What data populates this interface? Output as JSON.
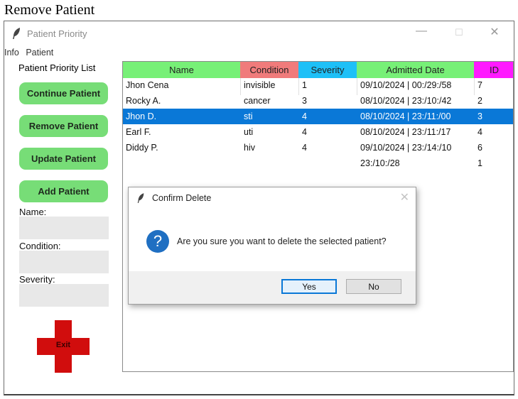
{
  "caption": "Remove Patient",
  "window": {
    "title": "Patient Priority",
    "controls": {
      "minimize": "—",
      "maximize": "☐",
      "close": "✕"
    }
  },
  "menu": [
    "Info",
    "Patient"
  ],
  "sidebar": {
    "title": "Patient Priority List",
    "buttons": [
      "Continue Patient",
      "Remove Patient",
      "Update Patient",
      "Add Patient"
    ],
    "fields": [
      {
        "label": "Name:",
        "value": ""
      },
      {
        "label": "Condition:",
        "value": ""
      },
      {
        "label": "Severity:",
        "value": ""
      }
    ],
    "exit_label": "Exit"
  },
  "table": {
    "columns": [
      {
        "label": "Name",
        "color": "#77f077"
      },
      {
        "label": "Condition",
        "color": "#f07b7b"
      },
      {
        "label": "Severity",
        "color": "#1ec0f7"
      },
      {
        "label": "Admitted Date",
        "color": "#77f077"
      },
      {
        "label": "ID",
        "color": "#ff1aff"
      }
    ],
    "rows": [
      {
        "name": "Jhon Cena",
        "condition": "invisible",
        "severity": "1",
        "date": "09/10/2024 | 00:/29:/58",
        "id": "7"
      },
      {
        "name": "Rocky A.",
        "condition": "cancer",
        "severity": "3",
        "date": "08/10/2024 | 23:/10:/42",
        "id": "2"
      },
      {
        "name": "Jhon D.",
        "condition": "sti",
        "severity": "4",
        "date": "08/10/2024 | 23:/11:/00",
        "id": "3"
      },
      {
        "name": "Earl F.",
        "condition": "uti",
        "severity": "4",
        "date": "08/10/2024 | 23:/11:/17",
        "id": "4"
      },
      {
        "name": "Diddy P.",
        "condition": "hiv",
        "severity": "4",
        "date": "09/10/2024 | 23:/14:/10",
        "id": "6"
      },
      {
        "name": "",
        "condition": "",
        "severity": "",
        "date": "23:/10:/28",
        "id": "1"
      }
    ],
    "selected_index": 2
  },
  "dialog": {
    "title": "Confirm Delete",
    "close": "✕",
    "icon": "?",
    "message": "Are you sure you want to delete the selected patient?",
    "yes": "Yes",
    "no": "No"
  }
}
